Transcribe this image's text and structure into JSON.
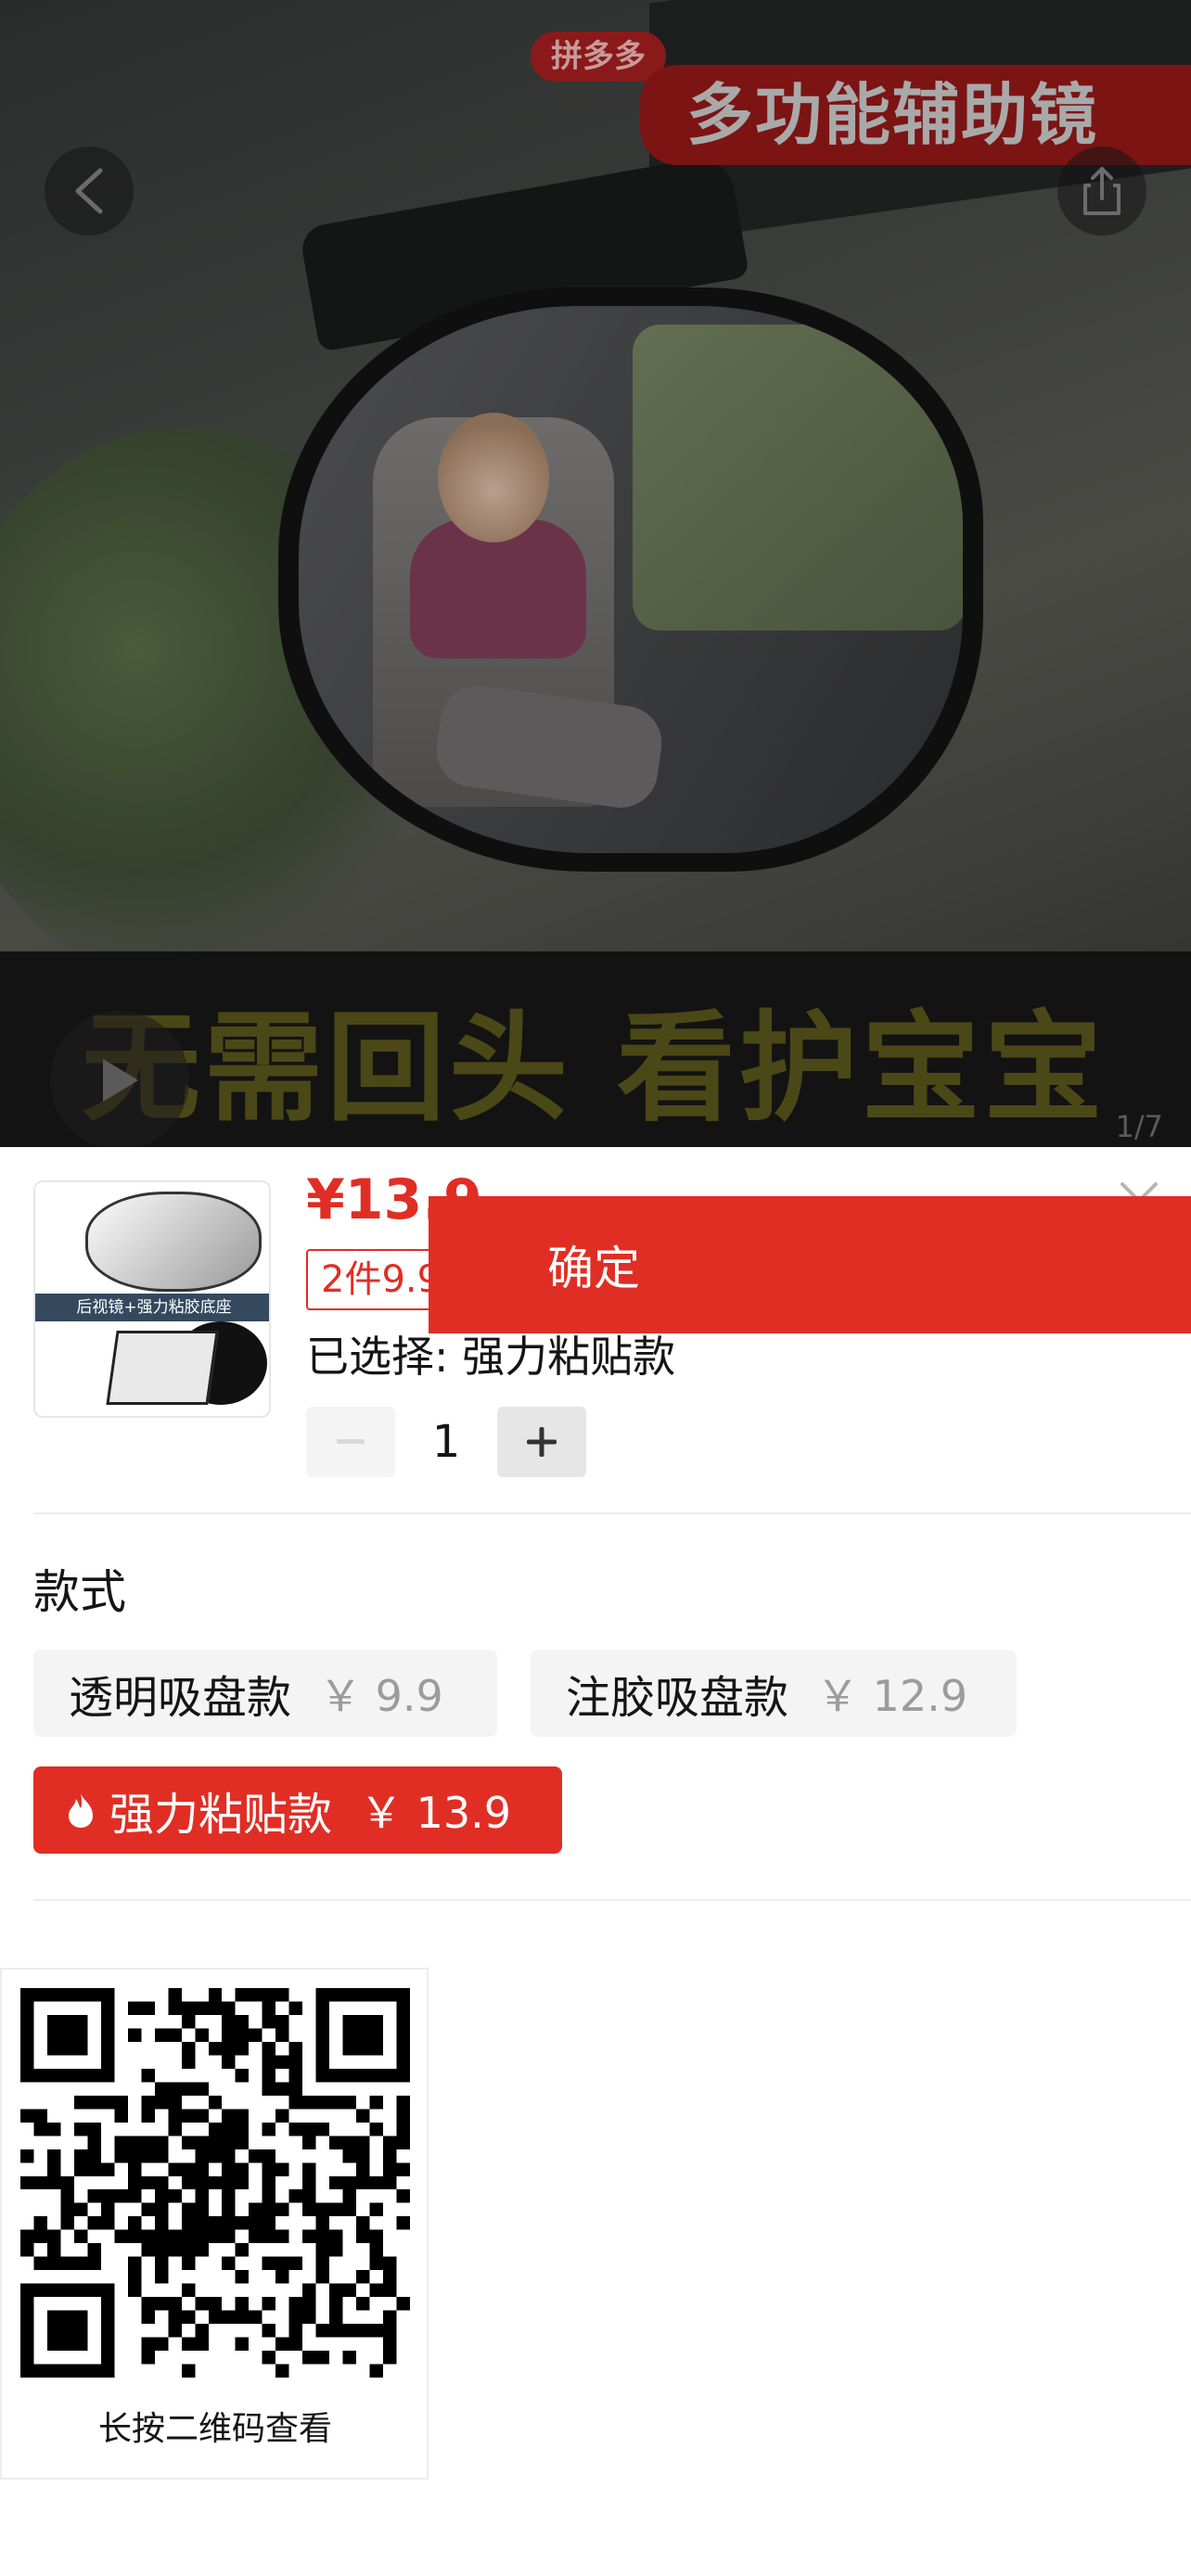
{
  "hero": {
    "brand_tag": "拼多多",
    "headline": "多功能辅助镜",
    "slogan": "无需回头 看护宝宝",
    "image_counter": "1/7",
    "back_icon": "chevron-left-icon",
    "share_icon": "share-icon",
    "play_icon": "play-icon"
  },
  "product": {
    "price": "¥13.9",
    "discount_badge": "2件9.9折",
    "selected_text": "已选择: 强力粘贴款",
    "thumbnail_caption": "后视镜+强力粘胶底座",
    "quantity": "1",
    "minus_icon": "minus-icon",
    "plus_icon": "plus-icon",
    "close_icon": "close-icon"
  },
  "styles": {
    "title": "款式",
    "options": [
      {
        "name": "透明吸盘款",
        "price": "￥ 9.9",
        "selected": false
      },
      {
        "name": "注胶吸盘款",
        "price": "￥ 12.9",
        "selected": false
      },
      {
        "name": "强力粘贴款",
        "price": "￥ 13.9",
        "selected": true,
        "icon": "flame-icon"
      }
    ]
  },
  "footer": {
    "qr_label": "长按二维码查看",
    "confirm_label": "确定"
  },
  "colors": {
    "accent": "#e02e24",
    "option_bg": "#f4f4f4",
    "muted_price": "#9c9c9c"
  }
}
